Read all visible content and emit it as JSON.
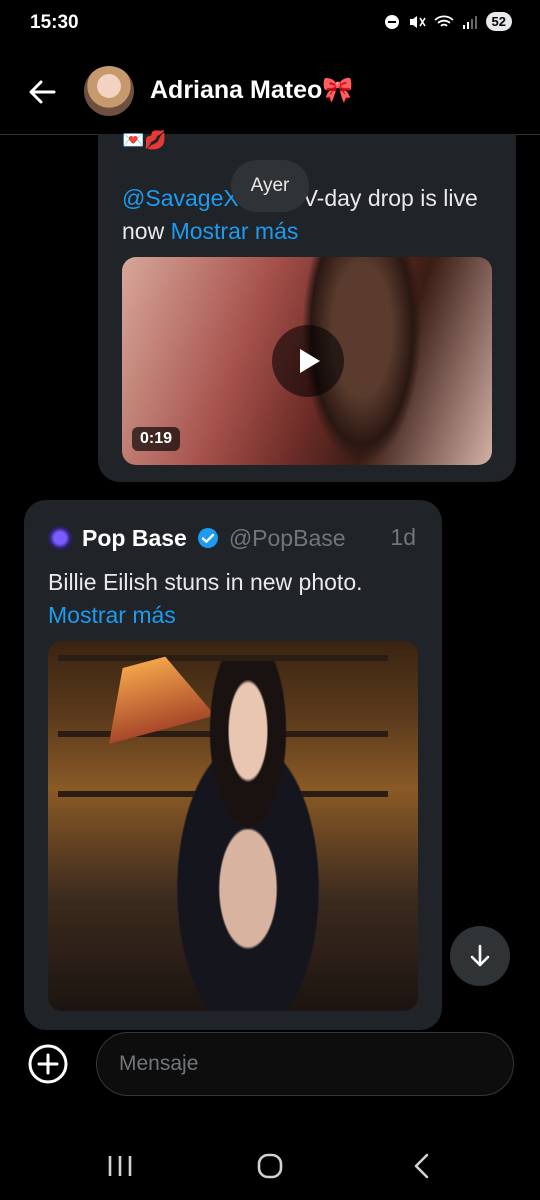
{
  "status_bar": {
    "time": "15:30",
    "battery": "52"
  },
  "header": {
    "contact_name": "Adriana Mateo🎀"
  },
  "date_separator": "Ayer",
  "message1": {
    "emoji_row": "💌💋",
    "mention": "@SavageXFenty",
    "text": " V-day drop is live now ",
    "more": "Mostrar más",
    "video_duration": "0:19"
  },
  "message2": {
    "author_name": "Pop Base",
    "author_handle": "@PopBase",
    "time": "1d",
    "text": "Billie Eilish stuns in new photo.",
    "more": "Mostrar más"
  },
  "composer": {
    "placeholder": "Mensaje"
  },
  "colors": {
    "accent": "#1d9bf0",
    "bubble": "#202327",
    "verified": "#1d9bf0"
  },
  "icons": [
    "back-arrow-icon",
    "play-icon",
    "verified-badge-icon",
    "arrow-down-icon",
    "plus-circle-icon",
    "recents-icon",
    "home-icon",
    "back-nav-icon"
  ]
}
